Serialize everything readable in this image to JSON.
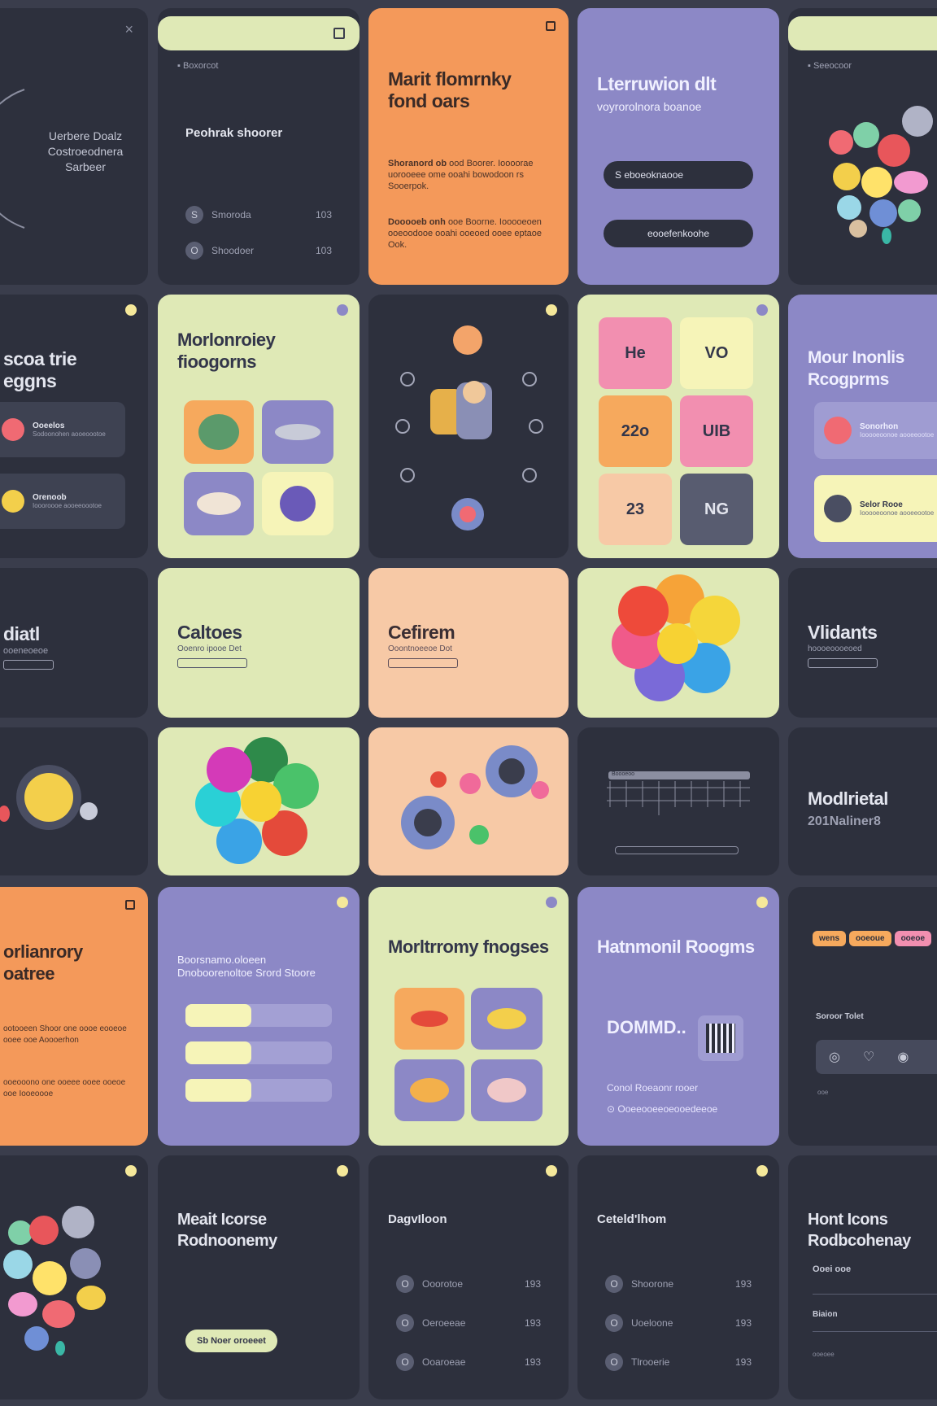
{
  "cards": {
    "c1": {
      "lines": [
        "Uerbere Doalz",
        "Costroeodnera",
        "Sarbeer"
      ]
    },
    "c2": {
      "header": "Boxorcot",
      "heading": "Peohrak shoorer",
      "rows": [
        {
          "icon": "S",
          "label": "Smoroda",
          "num": "103"
        },
        {
          "icon": "O",
          "label": "Shoodoer",
          "num": "103"
        }
      ]
    },
    "c3": {
      "title": "Marit flomrnky fond oars",
      "para1_lead": "Shoranord ob",
      "para1": "ood Boorer. Ioooorae uorooeee ome ooahi bowodoon rs Sooerpok.",
      "para2_lead": "Dooooeb onh",
      "para2": "ooe Boorne. Iooooeoen ooeoodooe ooahi ooeoed ooee eptaoe Ook."
    },
    "c4": {
      "title": "Lterruwion dlt",
      "sub": "voyrorolnora boanoe",
      "btn1": "S eboeoknaooe",
      "btn2": "eooefenkoohe"
    },
    "c5": {
      "header": "Seeocoor"
    },
    "c6": {
      "title": "scoa trie eggns",
      "items": [
        {
          "title": "Ooeelos",
          "text": "Sodoonohen aooeoootoe"
        },
        {
          "title": "Orenoob",
          "text": "Ioooroooe aooeeoootoe"
        }
      ]
    },
    "c7": {
      "title": "Morlonroiey fioogorns"
    },
    "c9": {
      "stats": [
        "He",
        "VO",
        "22o",
        "UIB",
        "23",
        "NG"
      ]
    },
    "c10": {
      "title": "Mour Inonlis Rcogprms",
      "items": [
        {
          "title": "Sonorhon",
          "text": "Iooooeoonoe aooeeootoe"
        },
        {
          "title": "Selor Rooe",
          "text": "Iooooeoonoe aooeeootoe"
        }
      ]
    },
    "c11": {
      "title": "diatl",
      "sub": "ooeneoeoe"
    },
    "c12": {
      "title": "Caltoes",
      "sub": "Ooenro ipooe Det"
    },
    "c13": {
      "title": "Cefirem",
      "sub": "Ooontnoeeoe Dot"
    },
    "c15": {
      "title": "Vlidants",
      "sub": "hoooeoooeoed"
    },
    "c19": {
      "ruler_label": "Boooeoo"
    },
    "c20": {
      "title": "Modlrietal",
      "sub": "201Naliner8"
    },
    "c21": {
      "title": "orlianrory oatree",
      "p1": "ootooeen Shoor one oooe eooeoe ooee ooe Aoooerhon",
      "p2": "ooeooono one ooeee ooee ooeoe ooe Iooeoooe"
    },
    "c22": {
      "title": "Boorsnamo.oloeen Dnoboorenoltoe Srord Stoore"
    },
    "c23": {
      "title": "Morltrromy fnogses"
    },
    "c24": {
      "title": "Hatnmonil Roogms",
      "big": "DOMMD..",
      "line1": "Conol Roeaonr rooer",
      "line2": "Ooeeooeeoeooedeeoe"
    },
    "c25": {
      "tags": [
        "wens",
        "ooeoue",
        "ooeoe"
      ],
      "label": "Soroor Tolet",
      "foot": "ooe"
    },
    "c27": {
      "title": "Meait Icorse Rodnoonemy",
      "btn": "Sb Noer oroeeet"
    },
    "c28": {
      "title": "DagvIloon",
      "rows": [
        {
          "icon": "O",
          "label": "Ooorotoe",
          "num": "193"
        },
        {
          "icon": "O",
          "label": "Oeroeeae",
          "num": "193"
        },
        {
          "icon": "O",
          "label": "Ooaroeae",
          "num": "193"
        }
      ]
    },
    "c29": {
      "title": "Ceteld'lhom",
      "rows": [
        {
          "icon": "O",
          "label": "Shoorone",
          "num": "193"
        },
        {
          "icon": "O",
          "label": "Uoeloone",
          "num": "193"
        },
        {
          "icon": "O",
          "label": "Tlrooerie",
          "num": "193"
        }
      ]
    },
    "c30": {
      "title": "Hont Icons Rodbcohenay",
      "l1": "Ooei ooe",
      "l2": "Biaion",
      "l3": "ooeoee"
    }
  },
  "colors": {
    "dark": "#2d303d",
    "lime": "#dfe9b6",
    "orange": "#f4995a",
    "lavender": "#8c88c6",
    "peach": "#f7c9a6",
    "accent_dot": "#f5e89a"
  }
}
